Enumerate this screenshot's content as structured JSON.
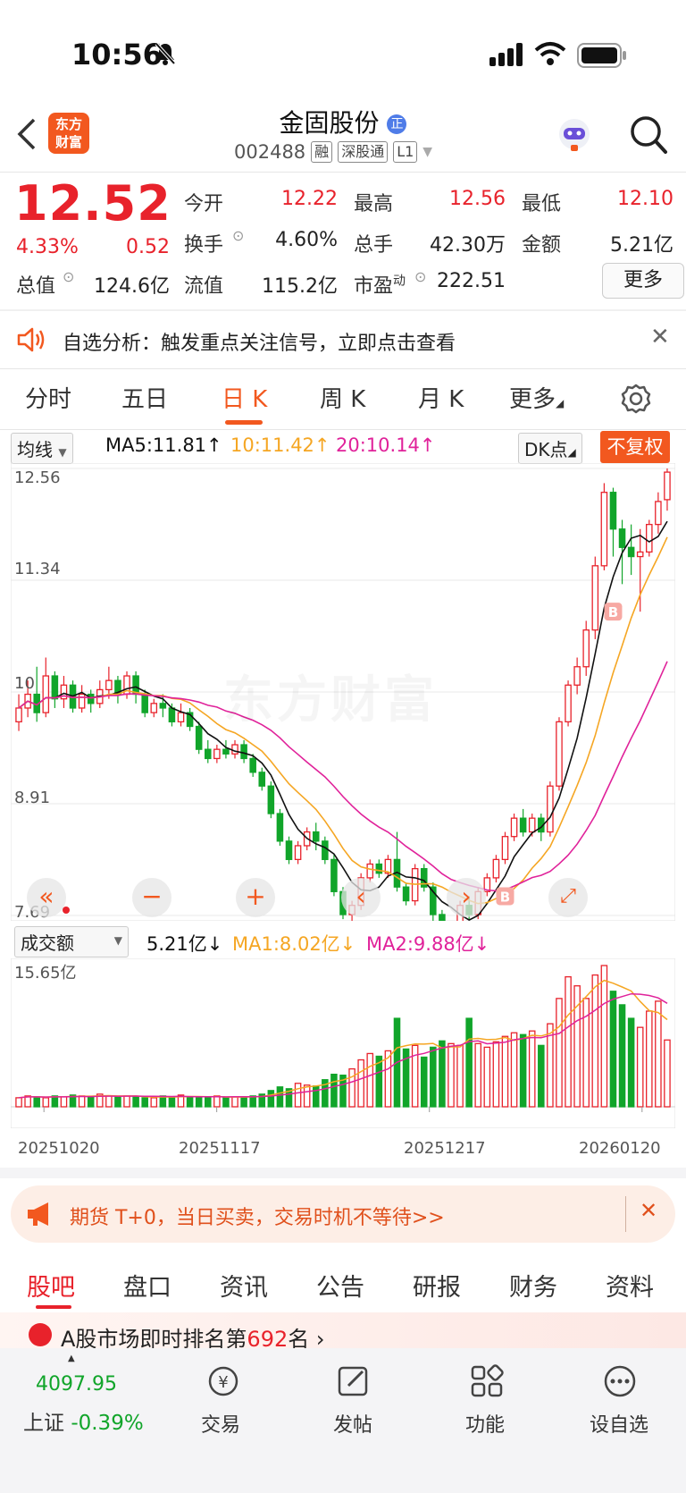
{
  "status_bar": {
    "time": "10:56"
  },
  "header": {
    "logo_text": "东方\n财富",
    "title": "金固股份",
    "title_badge": "正",
    "code": "002488",
    "tags": [
      "融",
      "深股通",
      "L1"
    ]
  },
  "quote": {
    "price": "12.52",
    "change_pct": "4.33%",
    "change": "0.52",
    "fields": [
      {
        "label": "今开",
        "value": "12.22",
        "color": "red"
      },
      {
        "label": "最高",
        "value": "12.56",
        "color": "red"
      },
      {
        "label": "最低",
        "value": "12.10",
        "color": "red"
      },
      {
        "label": "换手",
        "value": "4.60%",
        "color": "black"
      },
      {
        "label": "总手",
        "value": "42.30万",
        "color": "black"
      },
      {
        "label": "金额",
        "value": "5.21亿",
        "color": "black"
      },
      {
        "label": "总值",
        "value": "124.6亿",
        "color": "black"
      },
      {
        "label": "流值",
        "value": "115.2亿",
        "color": "black"
      },
      {
        "label": "市盈",
        "value": "222.51",
        "color": "black"
      }
    ],
    "pe_sup": "动",
    "more_label": "更多"
  },
  "notice": {
    "text": "自选分析：触发重点关注信号，立即点击查看"
  },
  "tabs": [
    "分时",
    "五日",
    "日 K",
    "周 K",
    "月 K",
    "更多"
  ],
  "active_tab": 2,
  "chart_toolbar": {
    "indicator": "均线",
    "ma5": "MA5:11.81↑",
    "ma10": "10:11.42↑",
    "ma20": "20:10.14↑",
    "dk": "DK点",
    "fq": "不复权"
  },
  "price_axis": [
    "12.56",
    "11.34",
    "10",
    "8.91",
    "7.69"
  ],
  "watermark": "东方财富",
  "vol_toolbar": {
    "indicator": "成交额",
    "value": "5.21亿↓",
    "ma1": "MA1:8.02亿↓",
    "ma2": "MA2:9.88亿↓"
  },
  "vol_axis_top": "15.65亿",
  "x_axis": [
    "20251020",
    "20251117",
    "20251217",
    "20260120"
  ],
  "colors": {
    "up": "#e8222b",
    "down": "#11a52a",
    "brand": "#f2581f",
    "ma5": "#111111",
    "ma10": "#f5a623",
    "ma20": "#e0229a"
  },
  "chart_data": {
    "type": "candlestick",
    "ylim": [
      7.69,
      12.56
    ],
    "ma_last": {
      "MA5": 11.81,
      "MA10": 11.42,
      "MA20": 10.14
    },
    "candles": [
      [
        9.8,
        9.95,
        10.1,
        9.7
      ],
      [
        9.95,
        10.1,
        10.25,
        9.85
      ],
      [
        10.1,
        9.9,
        10.4,
        9.8
      ],
      [
        9.9,
        10.3,
        10.5,
        9.85
      ],
      [
        10.3,
        10.05,
        10.35,
        9.95
      ],
      [
        10.05,
        10.2,
        10.3,
        9.95
      ],
      [
        10.2,
        9.95,
        10.25,
        9.9
      ],
      [
        9.95,
        10.1,
        10.2,
        9.9
      ],
      [
        10.1,
        10.0,
        10.15,
        9.9
      ],
      [
        10.0,
        10.15,
        10.25,
        9.95
      ],
      [
        10.15,
        10.25,
        10.4,
        10.05
      ],
      [
        10.25,
        10.1,
        10.3,
        10.0
      ],
      [
        10.1,
        10.3,
        10.35,
        10.05
      ],
      [
        10.3,
        10.1,
        10.35,
        10.0
      ],
      [
        10.1,
        9.9,
        10.15,
        9.85
      ],
      [
        9.9,
        10.0,
        10.05,
        9.85
      ],
      [
        10.0,
        9.95,
        10.1,
        9.85
      ],
      [
        9.95,
        9.8,
        10.0,
        9.75
      ],
      [
        9.8,
        9.9,
        10.0,
        9.75
      ],
      [
        9.9,
        9.75,
        9.95,
        9.7
      ],
      [
        9.75,
        9.5,
        9.8,
        9.45
      ],
      [
        9.5,
        9.4,
        9.6,
        9.35
      ],
      [
        9.4,
        9.5,
        9.55,
        9.35
      ],
      [
        9.5,
        9.45,
        9.6,
        9.4
      ],
      [
        9.45,
        9.55,
        9.6,
        9.4
      ],
      [
        9.55,
        9.4,
        9.6,
        9.35
      ],
      [
        9.4,
        9.25,
        9.45,
        9.2
      ],
      [
        9.25,
        9.1,
        9.3,
        9.05
      ],
      [
        9.1,
        8.8,
        9.15,
        8.75
      ],
      [
        8.8,
        8.5,
        8.85,
        8.45
      ],
      [
        8.5,
        8.3,
        8.55,
        8.25
      ],
      [
        8.3,
        8.45,
        8.5,
        8.25
      ],
      [
        8.45,
        8.6,
        8.65,
        8.4
      ],
      [
        8.6,
        8.5,
        8.7,
        8.4
      ],
      [
        8.5,
        8.3,
        8.55,
        8.25
      ],
      [
        8.3,
        7.95,
        8.35,
        7.9
      ],
      [
        7.95,
        7.7,
        8.0,
        7.65
      ],
      [
        7.7,
        7.8,
        7.85,
        7.6
      ],
      [
        7.8,
        8.1,
        8.15,
        7.75
      ],
      [
        8.1,
        8.25,
        8.3,
        8.05
      ],
      [
        8.25,
        8.15,
        8.3,
        8.1
      ],
      [
        8.15,
        8.3,
        8.35,
        8.1
      ],
      [
        8.3,
        8.0,
        8.6,
        7.95
      ],
      [
        8.0,
        7.85,
        8.05,
        7.8
      ],
      [
        7.85,
        8.2,
        8.25,
        7.8
      ],
      [
        8.2,
        8.0,
        8.25,
        7.95
      ],
      [
        8.0,
        7.7,
        8.05,
        7.6
      ],
      [
        7.7,
        7.45,
        7.75,
        7.35
      ],
      [
        7.45,
        7.55,
        7.6,
        7.35
      ],
      [
        7.55,
        7.8,
        7.85,
        7.5
      ],
      [
        7.8,
        7.7,
        7.9,
        7.65
      ],
      [
        7.7,
        7.95,
        8.0,
        7.65
      ],
      [
        7.95,
        8.1,
        8.15,
        7.9
      ],
      [
        8.1,
        8.3,
        8.35,
        8.05
      ],
      [
        8.3,
        8.55,
        8.6,
        8.25
      ],
      [
        8.55,
        8.75,
        8.8,
        8.5
      ],
      [
        8.75,
        8.6,
        8.85,
        8.55
      ],
      [
        8.6,
        8.75,
        8.8,
        8.55
      ],
      [
        8.75,
        8.6,
        8.8,
        8.5
      ],
      [
        8.6,
        9.1,
        9.15,
        8.55
      ],
      [
        9.1,
        9.8,
        9.85,
        9.05
      ],
      [
        9.8,
        10.2,
        10.25,
        9.75
      ],
      [
        10.2,
        10.4,
        10.5,
        10.1
      ],
      [
        10.4,
        10.8,
        10.9,
        10.3
      ],
      [
        10.8,
        11.5,
        11.6,
        10.7
      ],
      [
        11.5,
        12.3,
        12.4,
        11.45
      ],
      [
        12.3,
        11.9,
        12.35,
        11.6
      ],
      [
        11.9,
        11.7,
        12.0,
        11.3
      ],
      [
        11.7,
        11.6,
        11.95,
        11.4
      ],
      [
        11.6,
        11.65,
        11.9,
        11.0
      ],
      [
        11.65,
        11.95,
        12.0,
        11.6
      ],
      [
        11.95,
        12.2,
        12.3,
        11.85
      ],
      [
        12.22,
        12.52,
        12.56,
        12.1
      ]
    ],
    "volumes": [
      1.0,
      1.2,
      1.1,
      1.0,
      1.2,
      1.1,
      1.3,
      1.2,
      1.1,
      1.4,
      1.2,
      1.1,
      1.2,
      1.1,
      1.0,
      1.0,
      1.2,
      1.1,
      1.3,
      1.1,
      1.0,
      1.1,
      1.2,
      1.0,
      1.1,
      1.0,
      1.2,
      1.4,
      1.8,
      2.2,
      2.0,
      2.6,
      2.4,
      2.3,
      3.0,
      3.6,
      3.5,
      4.2,
      5.2,
      5.9,
      5.6,
      6.2,
      9.8,
      6.4,
      6.8,
      5.5,
      6.6,
      7.3,
      7.0,
      6.8,
      9.8,
      7.0,
      6.6,
      7.2,
      7.8,
      8.2,
      8.0,
      8.4,
      6.8,
      9.2,
      12.0,
      14.4,
      13.4,
      12.0,
      14.6,
      15.65,
      12.8,
      11.3,
      9.8,
      8.8,
      10.6,
      11.7,
      7.4
    ],
    "x_ticks": [
      "20251020",
      "20251117",
      "20251217",
      "20260120"
    ]
  },
  "promo": {
    "text": "期货 T+0，当日买卖，交易时机不等待>>"
  },
  "bottom_tabs": [
    "股吧",
    "盘口",
    "资讯",
    "公告",
    "研报",
    "财务",
    "资料"
  ],
  "bottom_active": 0,
  "ranking": {
    "prefix": "A股市场即时排名第",
    "rank": "692",
    "suffix": "名"
  },
  "bottom_nav": {
    "index_value": "4097.95",
    "index_name": "上证",
    "index_change": "-0.39%",
    "items": [
      "交易",
      "发帖",
      "功能",
      "设自选"
    ]
  }
}
